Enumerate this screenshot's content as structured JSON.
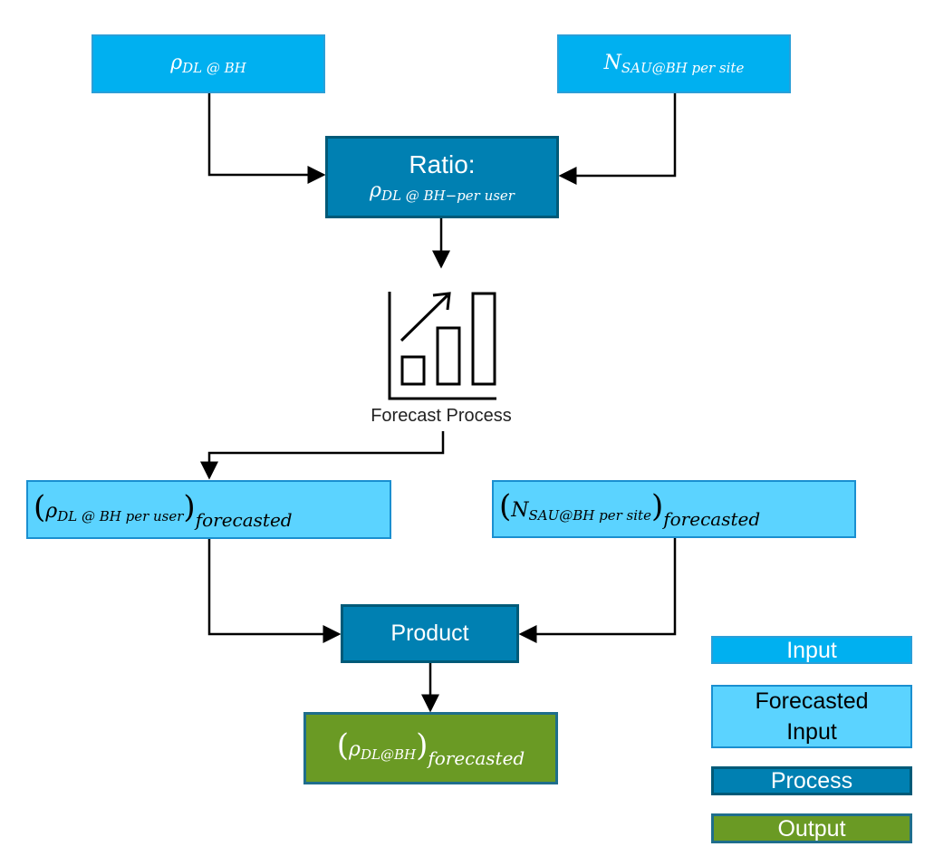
{
  "nodes": {
    "rho_dl_bh": {
      "base": "ρ",
      "sub": "DL @ BH"
    },
    "n_sau": {
      "base": "N",
      "sub": "SAU@BH per site"
    },
    "ratio": {
      "title": "Ratio:",
      "base": "ρ",
      "sub": "DL @ BH−per user"
    },
    "forecast_process": "Forecast Process",
    "rho_fc": {
      "open": "(",
      "base": "ρ",
      "sub": "DL @ BH per user",
      "close": ")",
      "outer": "forecasted"
    },
    "n_fc": {
      "open": "(",
      "base": "N",
      "sub": "SAU@BH per site",
      "close": ")",
      "outer": "forecasted"
    },
    "product": "Product",
    "output": {
      "open": "(",
      "base": "ρ",
      "sub": "DL@BH",
      "close": ")",
      "outer": "forecasted"
    }
  },
  "legend": [
    {
      "label": "Input",
      "color": "#00b0f0"
    },
    {
      "label": "Forecasted Input",
      "color": "#5bd3ff"
    },
    {
      "label": "Process",
      "color": "#0080b2"
    },
    {
      "label": "Output",
      "color": "#6a9a24"
    }
  ],
  "icons": {
    "forecast": "bar-chart-trend-icon"
  }
}
